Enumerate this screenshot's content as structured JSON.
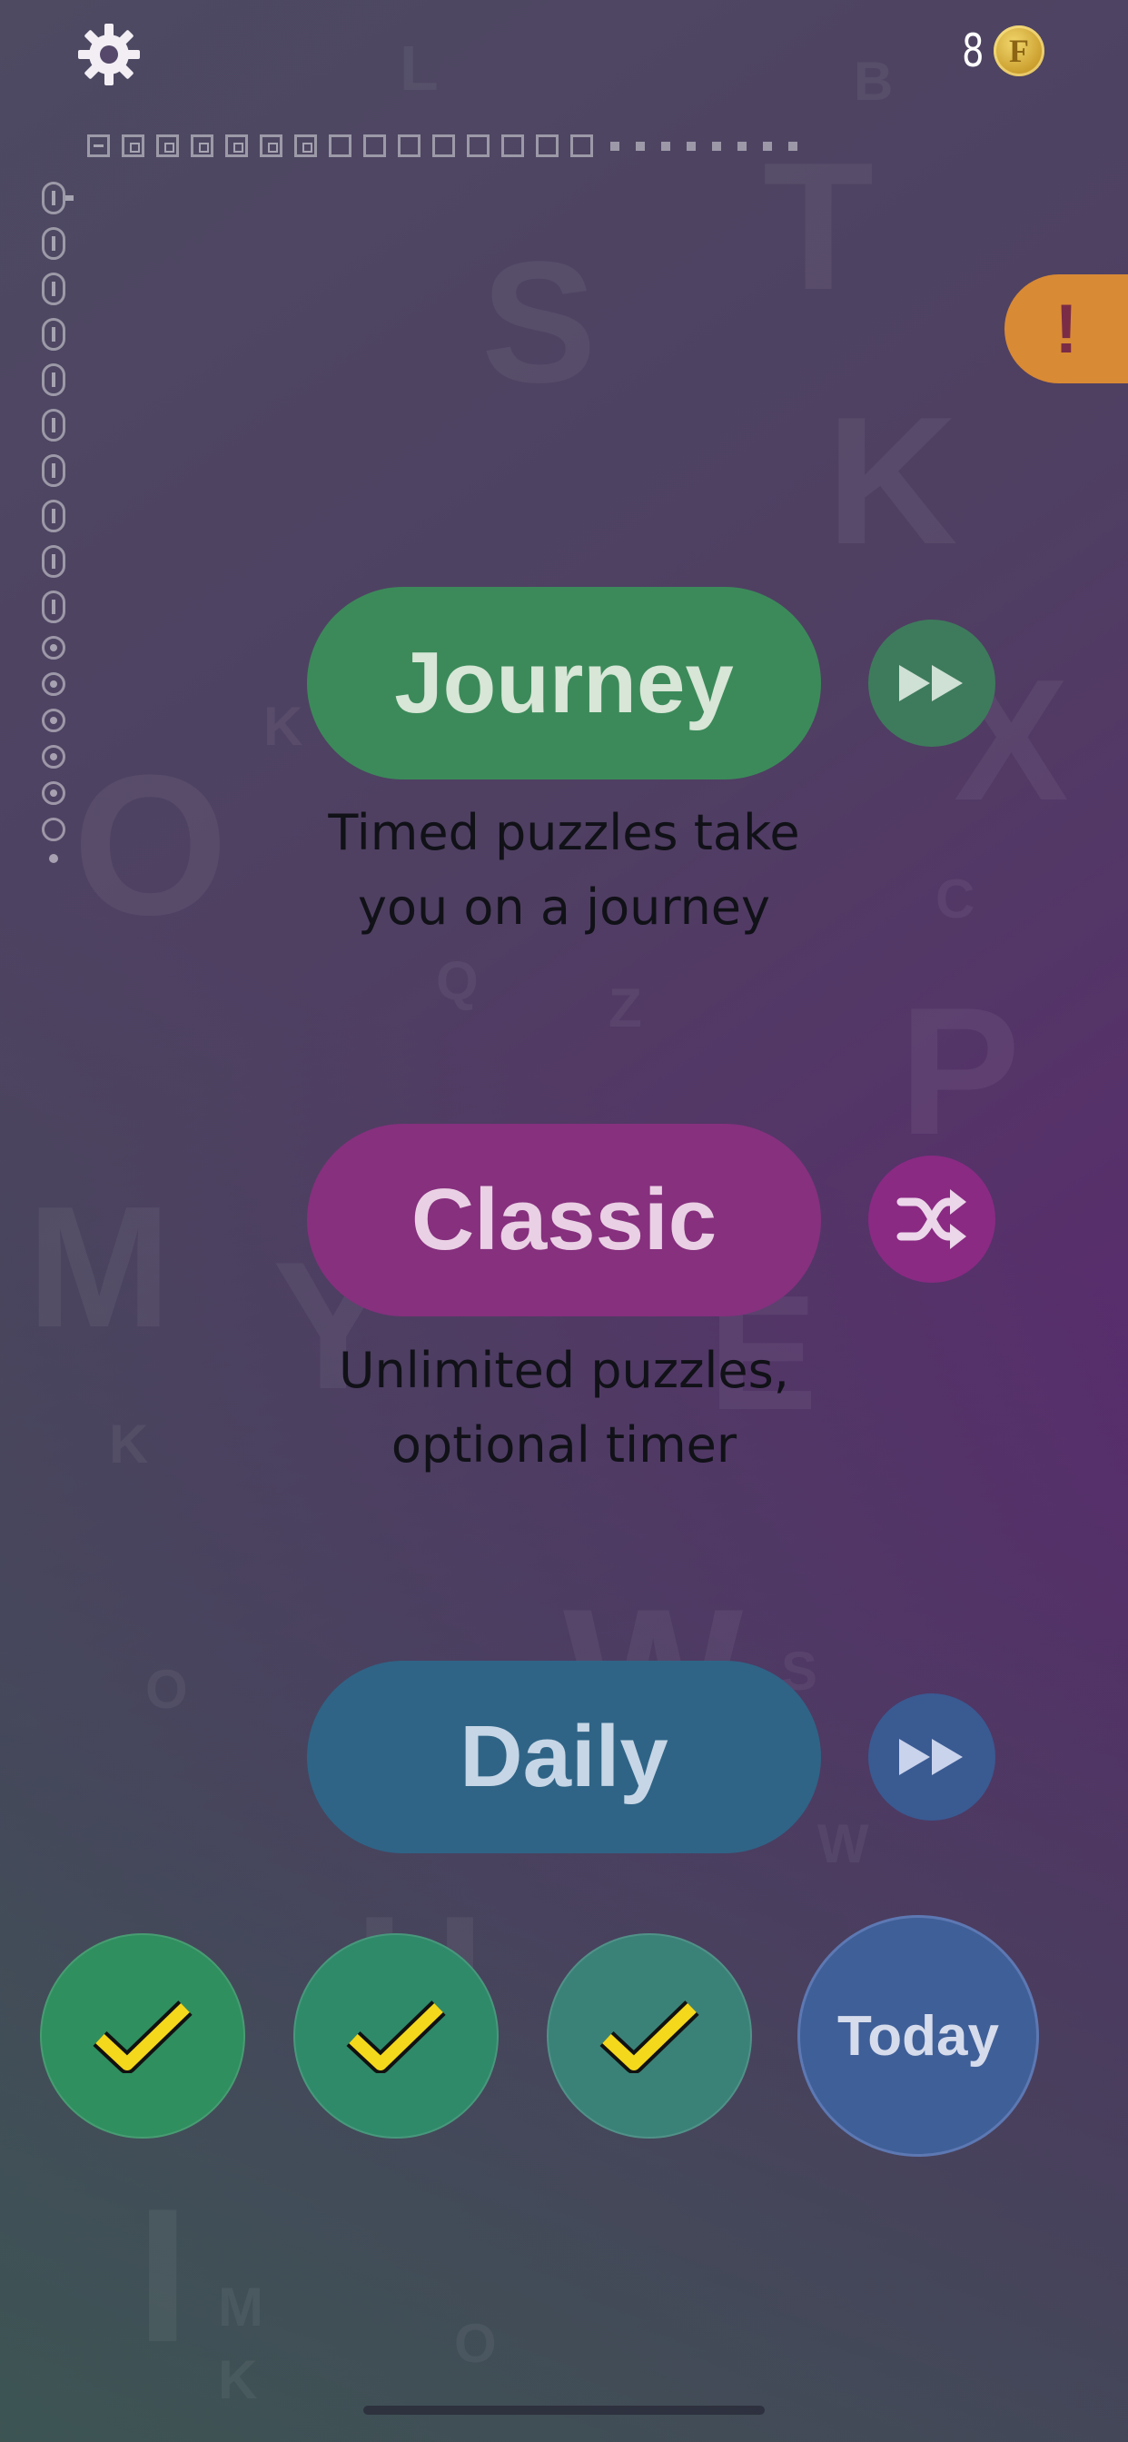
{
  "top_bar": {
    "coins": "8",
    "coin_symbol": "F"
  },
  "progress": {
    "horizontal_squares": 15,
    "horizontal_dots": 8,
    "vertical_pills": 10,
    "vertical_circles": 6
  },
  "alert": {
    "label": "!"
  },
  "modes": {
    "journey": {
      "label": "Journey",
      "desc_line1": "Timed puzzles take",
      "desc_line2": "you on a journey",
      "side_icon": "fast-forward-icon"
    },
    "classic": {
      "label": "Classic",
      "desc_line1": "Unlimited puzzles,",
      "desc_line2": "optional timer",
      "side_icon": "shuffle-icon"
    },
    "daily": {
      "label": "Daily",
      "side_icon": "fast-forward-icon"
    }
  },
  "daily_days": [
    {
      "completed": true
    },
    {
      "completed": true
    },
    {
      "completed": true
    }
  ],
  "today": {
    "label": "Today"
  },
  "colors": {
    "journey": "#3c8a5a",
    "classic": "#86307e",
    "daily": "#2f6486",
    "alert": "#d98a34",
    "check": "#f4d81c"
  }
}
